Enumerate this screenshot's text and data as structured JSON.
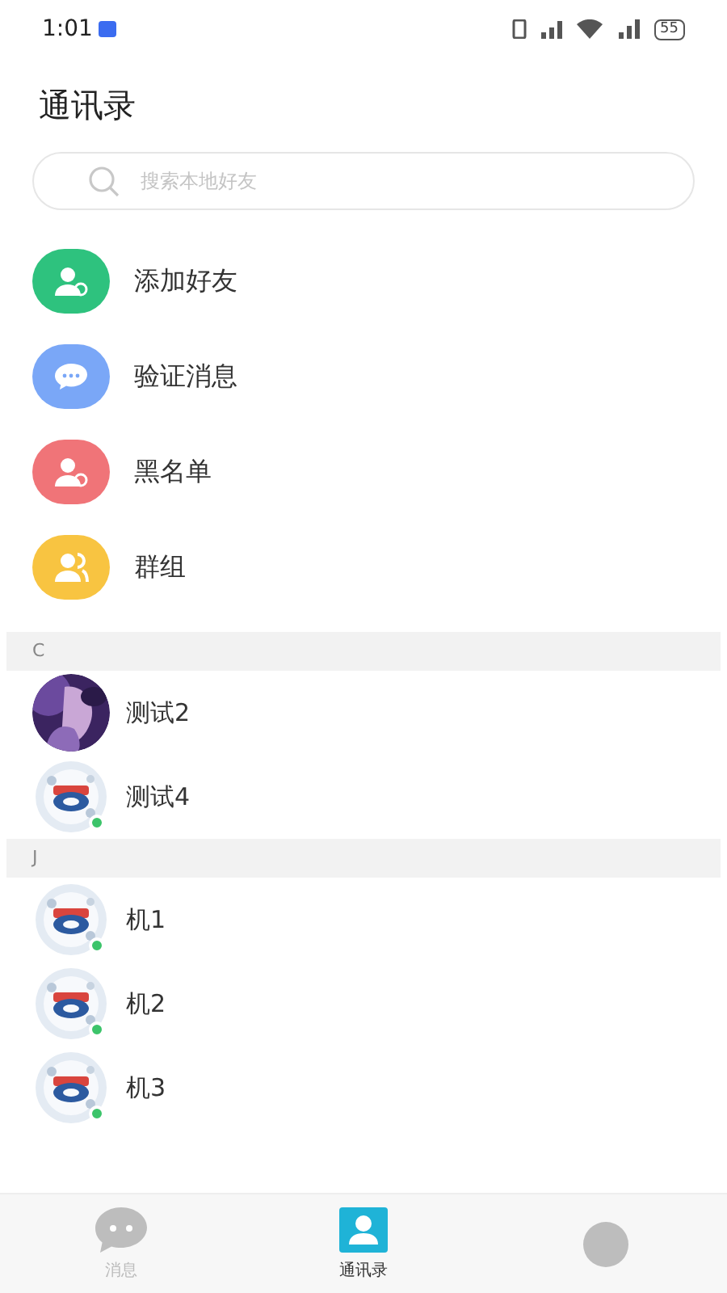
{
  "status_bar": {
    "time": "1:01",
    "battery": "55"
  },
  "title": "通讯录",
  "search": {
    "placeholder": "搜索本地好友"
  },
  "menu": [
    {
      "label": "添加好友",
      "kind": "add",
      "color": "#2ec27e"
    },
    {
      "label": "验证消息",
      "kind": "chat",
      "color": "#7aa7f7"
    },
    {
      "label": "黑名单",
      "kind": "block",
      "color": "#f07478"
    },
    {
      "label": "群组",
      "kind": "group",
      "color": "#f8c441"
    }
  ],
  "sections": [
    {
      "letter": "C",
      "contacts": [
        {
          "name": "测试2",
          "kind": "portrait",
          "online": false
        },
        {
          "name": "测试4",
          "kind": "badge",
          "online": true
        }
      ]
    },
    {
      "letter": "J",
      "contacts": [
        {
          "name": "机1",
          "kind": "badge",
          "online": true
        },
        {
          "name": "机2",
          "kind": "badge",
          "online": true
        },
        {
          "name": "机3",
          "kind": "badge",
          "online": true
        }
      ]
    }
  ],
  "tabs": [
    {
      "label": "消息",
      "kind": "chat",
      "selected": false
    },
    {
      "label": "通讯录",
      "kind": "contacts",
      "selected": true
    },
    {
      "kind": "me",
      "selected": false
    }
  ]
}
